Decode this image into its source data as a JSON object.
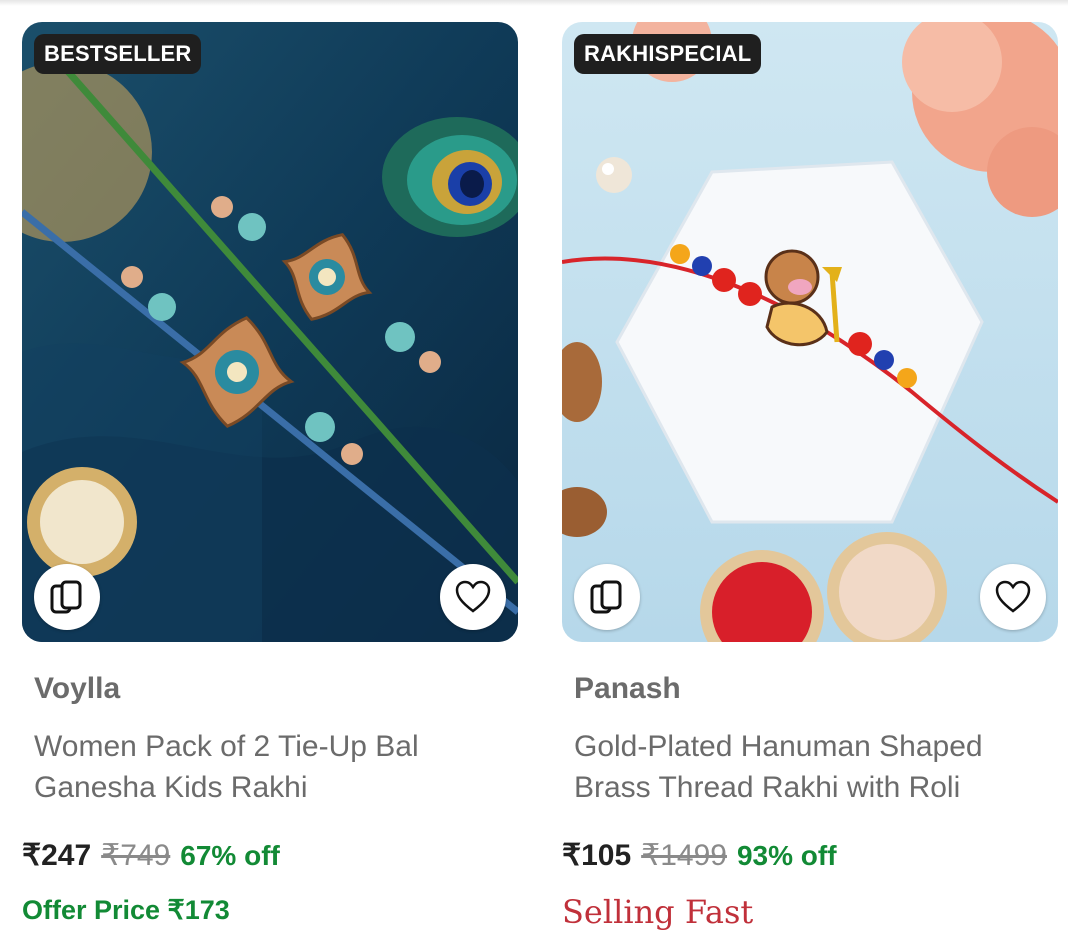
{
  "products": [
    {
      "tag": "BESTSELLER",
      "brand": "Voylla",
      "title": "Women Pack of 2 Tie-Up Bal Ganesha Kids Rakhi",
      "price": "₹247",
      "mrp": "₹749",
      "discount": "67% off",
      "offer_price": "Offer Price ₹173"
    },
    {
      "tag": "RAKHISPECIAL",
      "brand": "Panash",
      "title": "Gold-Plated Hanuman Shaped Brass Thread Rakhi with Roli",
      "price": "₹105",
      "mrp": "₹1499",
      "discount": "93% off",
      "status": "Selling Fast"
    }
  ],
  "icons": {
    "similar": "cards-icon",
    "wishlist": "heart-icon"
  },
  "colors": {
    "discount_green": "#128a35",
    "selling_fast_red": "#c0303a",
    "tag_bg": "#1f1f1f"
  }
}
